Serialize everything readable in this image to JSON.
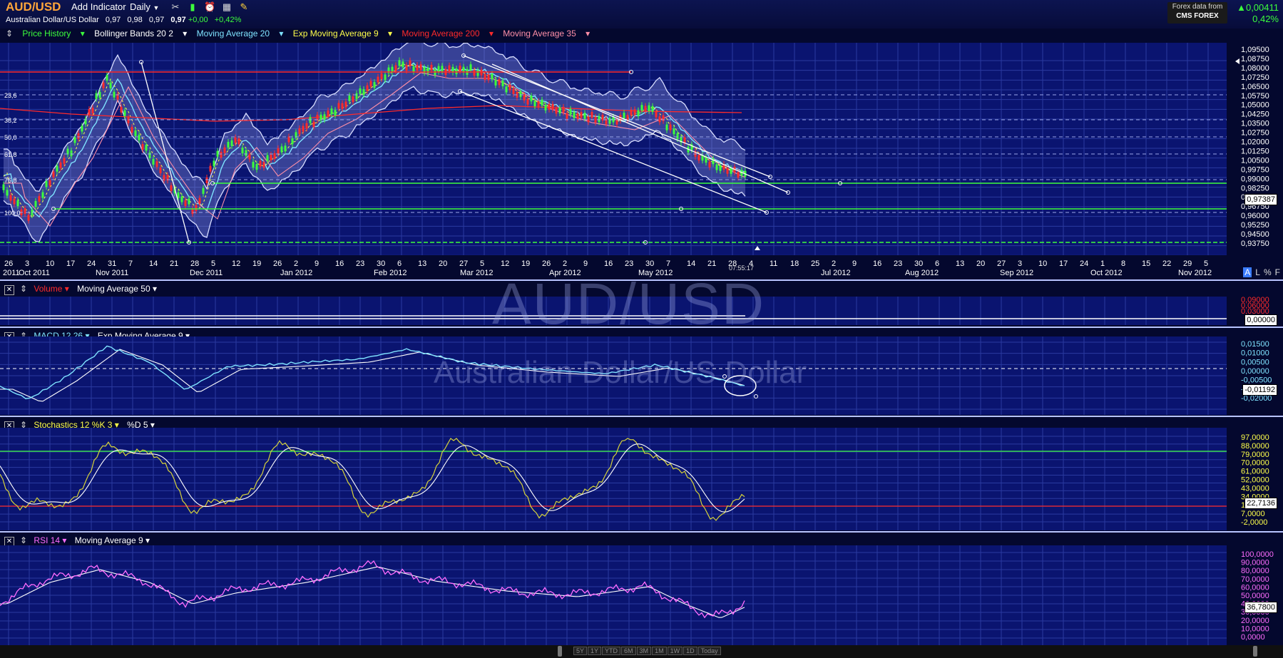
{
  "header": {
    "symbol": "AUD/USD",
    "add_indicator": "Add Indicator",
    "period": "Daily",
    "subtitle": "Australian Dollar/US Dollar",
    "open": "0,97",
    "high": "0,98",
    "low": "0,97",
    "last": "0,97",
    "change": "+0,00",
    "change_pct": "+0,42%",
    "forex_data_from": "Forex data from",
    "provider": "CMS FOREX",
    "right_change": "0,00411",
    "right_change_pct": "0,42%",
    "icons": [
      "tools-icon",
      "bar-chart-icon",
      "alarm-clock-icon",
      "calculator-icon",
      "notes-icon"
    ]
  },
  "legend": {
    "price_history": "Price History",
    "bollinger": "Bollinger Bands 20 2",
    "ma20": "Moving Average 20",
    "ema9": "Exp Moving Average 9",
    "ma200": "Moving Average 200",
    "ma35": "Moving Average 35"
  },
  "colors": {
    "bg": "#04082e",
    "panel": "#0a1470",
    "green": "#3cff3c",
    "red": "#ff2a2a",
    "cyan": "#7fe3ff",
    "yellow": "#ffff4a",
    "magenta": "#ff6cff",
    "orange": "#ffa53a"
  },
  "price_axis": [
    "1,09500",
    "1,08750",
    "1,08000",
    "1,07250",
    "1,06500",
    "1,05750",
    "1,05000",
    "1,04250",
    "1,03500",
    "1,02750",
    "1,02000",
    "1,01250",
    "1,00500",
    "0,99750",
    "0,99000",
    "0,98250",
    "0,97500",
    "0,96750",
    "0,96000",
    "0,95250",
    "0,94500",
    "0,93750"
  ],
  "price_current": "0,97387",
  "fib_labels": [
    "23,6",
    "38,2",
    "50,0",
    "61,8",
    "76,8",
    "100,0"
  ],
  "date_ticks": [
    "26",
    "3",
    "10",
    "17",
    "24",
    "31",
    "7",
    "14",
    "21",
    "28",
    "5",
    "12",
    "19",
    "26",
    "2",
    "9",
    "16",
    "23",
    "30",
    "6",
    "13",
    "20",
    "27",
    "5",
    "12",
    "19",
    "26",
    "2",
    "9",
    "16",
    "23",
    "30",
    "7",
    "14",
    "21",
    "28",
    "4",
    "11",
    "18",
    "25",
    "2",
    "9",
    "16",
    "23",
    "30",
    "6",
    "13",
    "20",
    "27",
    "3",
    "10",
    "17",
    "24",
    "1",
    "8",
    "15",
    "22",
    "29",
    "5"
  ],
  "month_labels": [
    "2011",
    "Oct 2011",
    "Nov 2011",
    "Dec 2011",
    "Jan 2012",
    "Feb 2012",
    "Mar 2012",
    "Apr 2012",
    "May 2012",
    "Jul 2012",
    "Aug 2012",
    "Sep 2012",
    "Oct 2012",
    "Nov 2012"
  ],
  "clock": "07:55:17",
  "mode_buttons": [
    "A",
    "L",
    "%",
    "F"
  ],
  "volume_panel": {
    "title": "Volume",
    "overlay": "Moving Average 50",
    "axis": [
      "0,09000",
      "0,06000",
      "0,03000"
    ],
    "current": "0,00000"
  },
  "macd_panel": {
    "title": "MACD 12 26",
    "overlay": "Exp Moving Average 9",
    "axis": [
      "0,01500",
      "0,01000",
      "0,00500",
      "0,00000",
      "-0,00500",
      "-0,01500",
      "-0,02000"
    ],
    "current": "-0,01192"
  },
  "stoch_panel": {
    "title": "Stochastics 12 %K 3",
    "overlay": "%D 5",
    "axis": [
      "97,0000",
      "88,0000",
      "79,0000",
      "70,0000",
      "61,0000",
      "52,0000",
      "43,0000",
      "34,0000",
      "16,0000",
      "7,0000",
      "-2,0000"
    ],
    "current": "22,7136"
  },
  "rsi_panel": {
    "title": "RSI 14",
    "overlay": "Moving Average 9",
    "axis": [
      "100,0000",
      "90,0000",
      "80,0000",
      "70,0000",
      "60,0000",
      "50,0000",
      "40,0000",
      "30,0000",
      "20,0000",
      "10,0000",
      "0,0000"
    ],
    "current": "36,7800"
  },
  "watermark": {
    "symbol": "AUD/USD",
    "name": "Australian Dollar/US Dollar"
  },
  "range_buttons": [
    "5Y",
    "1Y",
    "YTD",
    "6M",
    "3M",
    "1M",
    "1W",
    "1D",
    "Today"
  ]
}
